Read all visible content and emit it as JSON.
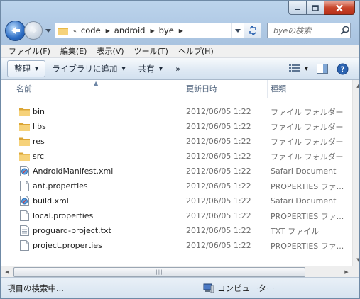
{
  "window": {
    "caption_buttons": {
      "minimize": "minimize",
      "maximize": "maximize",
      "close": "close"
    }
  },
  "navigation": {
    "breadcrumb_overflow": "«",
    "breadcrumbs": [
      "code",
      "android",
      "bye"
    ],
    "search_placeholder": "byeの検索"
  },
  "menu": [
    "ファイル(F)",
    "編集(E)",
    "表示(V)",
    "ツール(T)",
    "ヘルプ(H)"
  ],
  "commands": {
    "organize": "整理",
    "library": "ライブラリに追加",
    "share": "共有",
    "more": "»"
  },
  "columns": {
    "name": "名前",
    "date": "更新日時",
    "type": "種類"
  },
  "files": [
    {
      "name": "bin",
      "date": "2012/06/05 1:22",
      "type": "ファイル フォルダー",
      "icon": "folder-icon"
    },
    {
      "name": "libs",
      "date": "2012/06/05 1:22",
      "type": "ファイル フォルダー",
      "icon": "folder-icon"
    },
    {
      "name": "res",
      "date": "2012/06/05 1:22",
      "type": "ファイル フォルダー",
      "icon": "folder-icon"
    },
    {
      "name": "src",
      "date": "2012/06/05 1:22",
      "type": "ファイル フォルダー",
      "icon": "folder-icon"
    },
    {
      "name": "AndroidManifest.xml",
      "date": "2012/06/05 1:22",
      "type": "Safari Document",
      "icon": "safari-doc-icon"
    },
    {
      "name": "ant.properties",
      "date": "2012/06/05 1:22",
      "type": "PROPERTIES ファ...",
      "icon": "file-icon"
    },
    {
      "name": "build.xml",
      "date": "2012/06/05 1:22",
      "type": "Safari Document",
      "icon": "safari-doc-icon"
    },
    {
      "name": "local.properties",
      "date": "2012/06/05 1:22",
      "type": "PROPERTIES ファ...",
      "icon": "file-icon"
    },
    {
      "name": "proguard-project.txt",
      "date": "2012/06/05 1:22",
      "type": "TXT ファイル",
      "icon": "text-file-icon"
    },
    {
      "name": "project.properties",
      "date": "2012/06/05 1:22",
      "type": "PROPERTIES ファ...",
      "icon": "file-icon"
    }
  ],
  "status": {
    "left": "項目の検索中...",
    "right": "コンピューター"
  }
}
